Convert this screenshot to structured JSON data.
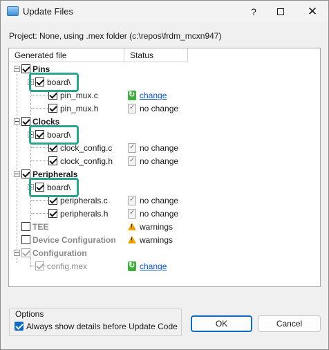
{
  "window": {
    "title": "Update Files",
    "help_glyph": "?",
    "close_glyph": "✕"
  },
  "project_line": "Project: None, using .mex folder (c:\\repos\\frdm_mcxn947)",
  "columns": {
    "file": "Generated file",
    "status": "Status"
  },
  "tree": {
    "pins": {
      "label": "Pins",
      "folder": "board\\",
      "files": [
        {
          "name": "pin_mux.c",
          "status": "change"
        },
        {
          "name": "pin_mux.h",
          "status": "no change"
        }
      ]
    },
    "clocks": {
      "label": "Clocks",
      "folder": "board\\",
      "files": [
        {
          "name": "clock_config.c",
          "status": "no change"
        },
        {
          "name": "clock_config.h",
          "status": "no change"
        }
      ]
    },
    "peripherals": {
      "label": "Peripherals",
      "folder": "board\\",
      "files": [
        {
          "name": "peripherals.c",
          "status": "no change"
        },
        {
          "name": "peripherals.h",
          "status": "no change"
        }
      ]
    },
    "tee": {
      "label": "TEE",
      "status": "warnings"
    },
    "device_configuration": {
      "label": "Device Configuration",
      "status": "warnings"
    },
    "configuration": {
      "label": "Configuration",
      "files": [
        {
          "name": "config.mex",
          "status": "change"
        }
      ]
    }
  },
  "options": {
    "title": "Options",
    "always_show_details": "Always show details before Update Code"
  },
  "buttons": {
    "ok": "OK",
    "cancel": "Cancel"
  },
  "colors": {
    "highlight": "#2aa38f",
    "link": "#0a56c2",
    "accent": "#0f6cbd"
  }
}
